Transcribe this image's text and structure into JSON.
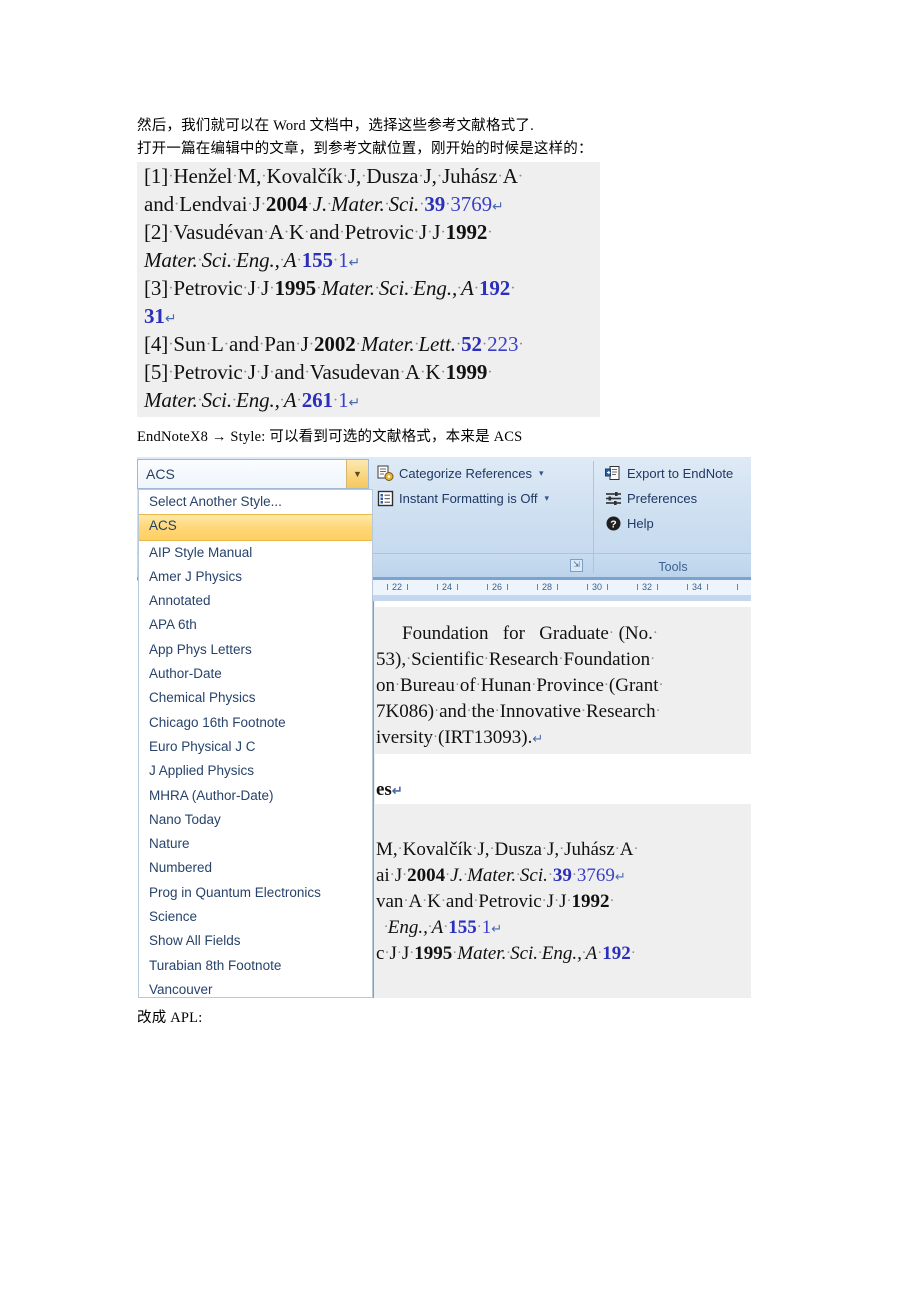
{
  "document": {
    "line_1": "然后，我们就可以在 Word 文档中，选择这些参考文献格式了.",
    "line_2": "打开一篇在编辑中的文章，到参考文献位置，刚开始的时候是这样的：",
    "line_endnote": "EndNoteX8 → Style: 可以看到可选的文献格式，本来是 ACS",
    "line_apl": "改成 APL:"
  },
  "reference_block": {
    "lines": [
      "[1]·Henžel·M,·Kovalčík·J,·Dusza·J,·Juhász·A·",
      "and·Lendvai·J·2004·J.·Mater.·Sci.·39·3769↵",
      "[2]·Vasudévan·A·K·and·Petrovic·J·J·1992·",
      "Mater.·Sci.·Eng.,·A·155·1↵",
      "[3]·Petrovic·J·J·1995·Mater.·Sci.·Eng.,·A·192·",
      "31↵",
      "[4]·Sun·L·and·Pan·J·2002·Mater.·Lett.·52·223·",
      "[5]·Petrovic·J·J·and·Vasudevan·A·K·1999·",
      "Mater.·Sci.·Eng.,·A·261·1↵"
    ]
  },
  "endnote_ui": {
    "style_combo": {
      "value": "ACS",
      "arrow_icon": "chevron-down-icon"
    },
    "style_options": [
      "Select Another Style...",
      "ACS",
      "AIP Style Manual",
      "Amer J Physics",
      "Annotated",
      "APA 6th",
      "App Phys Letters",
      "Author-Date",
      "Chemical Physics",
      "Chicago 16th Footnote",
      "Euro Physical J C",
      "J Applied Physics",
      "MHRA (Author-Date)",
      "Nano Today",
      "Nature",
      "Numbered",
      "Prog in Quantum Electronics",
      "Science",
      "Show All Fields",
      "Turabian 8th Footnote",
      "Vancouver"
    ],
    "selected_option": "ACS",
    "ribbon": {
      "bibliography_group": {
        "label": "",
        "items": [
          {
            "label": "Categorize References",
            "icon": "categorize-references-icon",
            "has_caret": true
          },
          {
            "label": "Instant Formatting is Off",
            "icon": "instant-formatting-icon",
            "has_caret": true
          }
        ],
        "dialog_launcher_icon": "dialog-launcher-icon"
      },
      "tools_group": {
        "label": "Tools",
        "items": [
          {
            "label": "Export to EndNote",
            "icon": "export-to-endnote-icon",
            "has_caret": false
          },
          {
            "label": "Preferences",
            "icon": "preferences-icon",
            "has_caret": false
          },
          {
            "label": "Help",
            "icon": "help-icon",
            "has_caret": false
          }
        ]
      }
    },
    "word_pane": {
      "ruler_numbers": [
        "22",
        "24",
        "26",
        "28",
        "30",
        "32",
        "34"
      ],
      "paragraph_lines": [
        "Foundation    for    Graduate    (No.·",
        "53),·Scientific·Research·Foundation·",
        "on·Bureau·of·Hunan·Province·(Grant·",
        "7K086)·and·the·Innovative·Research·",
        "iversity·(IRT13093).↵"
      ],
      "heading_fragment": "es↵",
      "reference_lines": [
        "M,·Kovalčík·J,·Dusza·J,·Juhász·A·",
        "ai·J·2004·J.·Mater.·Sci.·39·3769↵",
        "van·A·K·and·Petrovic·J·J·1992·",
        "·Eng.,·A·155·1↵",
        "c·J·J·1995·Mater.·Sci.·Eng.,·A·192·"
      ]
    }
  },
  "colors": {
    "ribbon_blue": "#d4e3f2",
    "highlight_amber": "#ffd778",
    "link_blue": "#27436b",
    "volume_blue": "#2b2fbb",
    "screenshot_grey": "#efefef"
  }
}
